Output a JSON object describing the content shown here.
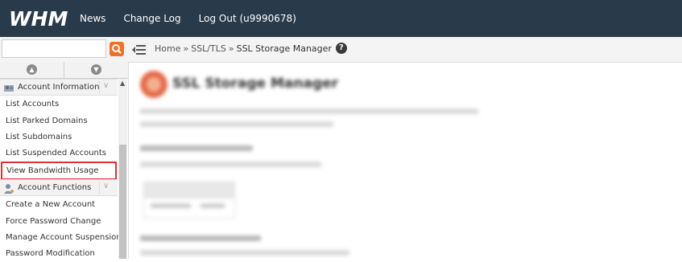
{
  "app": {
    "logo_text": "WHM",
    "nav": [
      "News",
      "Change Log",
      "Log Out (u9990678)"
    ]
  },
  "search": {
    "value": "",
    "placeholder": ""
  },
  "breadcrumb": {
    "home": "Home",
    "sep": "»",
    "section": "SSL/TLS",
    "current": "SSL Storage Manager",
    "help": "?"
  },
  "sidebar": {
    "sections": [
      {
        "title": "Account Information",
        "icon": "account-info-icon",
        "items": [
          "List Accounts",
          "List Parked Domains",
          "List Subdomains",
          "List Suspended Accounts",
          "View Bandwidth Usage"
        ]
      },
      {
        "title": "Account Functions",
        "icon": "account-functions-icon",
        "items": [
          "Create a New Account",
          "Force Password Change",
          "Manage Account Suspension",
          "Password Modification"
        ]
      }
    ],
    "highlighted_item": "View Bandwidth Usage"
  },
  "main": {
    "title": "SSL Storage Manager",
    "blurred": true
  },
  "colors": {
    "topbar": "#293a4a",
    "search_button": "#f0722a",
    "highlight_border": "#e03030"
  }
}
